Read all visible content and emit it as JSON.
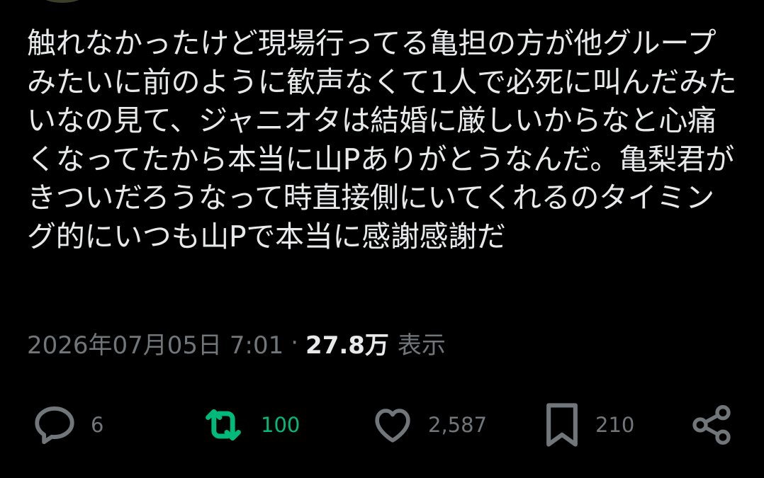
{
  "tweet": {
    "text": "触れなかったけど現場行ってる亀担の方が他グループみたいに前のように歓声なくて1人で必死に叫んだみたいなの見て、ジャニオタは結婚に厳しいからなと心痛くなってたから本当に山Pありがとうなんだ。亀梨君がきついだろうなって時直接側にいてくれるのタイミング的にいつも山Pで本当に感謝感謝だ",
    "timestamp": "2026年07月05日 7:01",
    "separator": "·",
    "views_count": "27.8万",
    "views_label": "表示"
  },
  "actions": {
    "reply": {
      "icon": "reply-bubble-icon",
      "count": "6"
    },
    "retweet": {
      "icon": "retweet-icon",
      "count": "100",
      "color": "#00ba7c"
    },
    "like": {
      "icon": "heart-icon",
      "count": "2,587"
    },
    "bookmark": {
      "icon": "bookmark-icon",
      "count": "210"
    },
    "share": {
      "icon": "share-icon"
    }
  },
  "colors": {
    "background": "#000000",
    "text": "#e7e9ea",
    "muted": "#71767b",
    "retweet_active": "#00ba7c"
  }
}
